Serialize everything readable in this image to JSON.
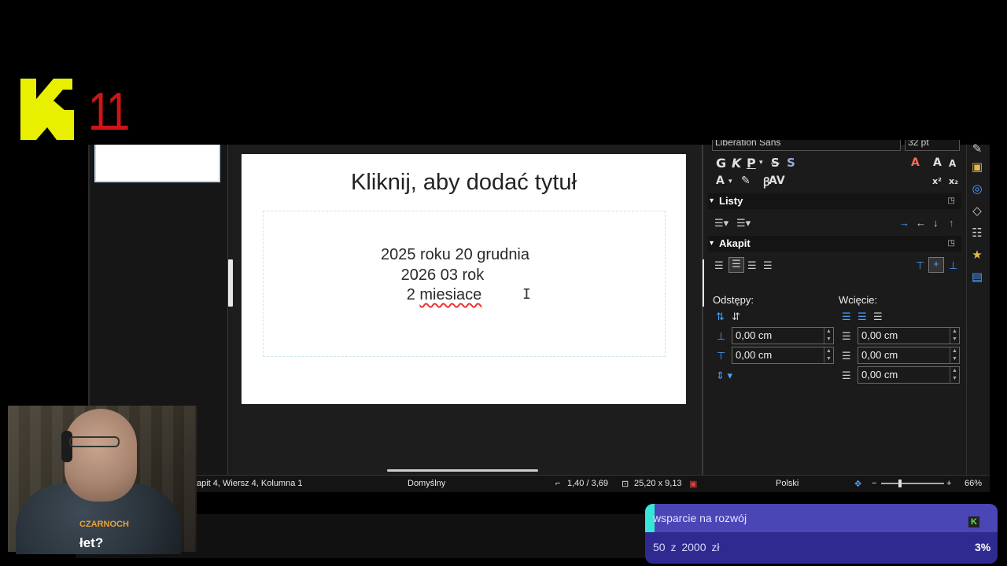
{
  "logo": {
    "number": "11",
    "accent_color": "#e8f000",
    "number_color": "#d01414"
  },
  "sidebar": {
    "font_name": "Liberation Sans",
    "font_size": "32 pt",
    "sections": {
      "lists": "Listy",
      "paragraph": "Akapit"
    },
    "spacing_label": "Odstępy:",
    "indent_label": "Wcięcie:",
    "spacing": {
      "above": "0,00 cm",
      "below": "0,00 cm"
    },
    "indent": {
      "before": "0,00 cm",
      "after": "0,00 cm",
      "first_line": "0,00 cm"
    }
  },
  "slide": {
    "title": "Kliknij, aby dodać tytuł",
    "line1": "2025 roku 20 grudnia",
    "line2": "2026 03  rok",
    "line3_num": "2",
    "line3_word": "miesiace"
  },
  "status": {
    "position": "apit 4, Wiersz 4, Kolumna 1",
    "layout": "Domyślny",
    "cursor_pos": "1,40 / 3,69",
    "size": "25,20 x 9,13",
    "language": "Polski",
    "zoom": "66%"
  },
  "webcam": {
    "name": "CZARNOCH",
    "caption": "łet?"
  },
  "donation": {
    "title": "wsparcie na rozwój",
    "amount": "50 z 2000 zł",
    "percent": "3%",
    "progress": 0.025
  }
}
